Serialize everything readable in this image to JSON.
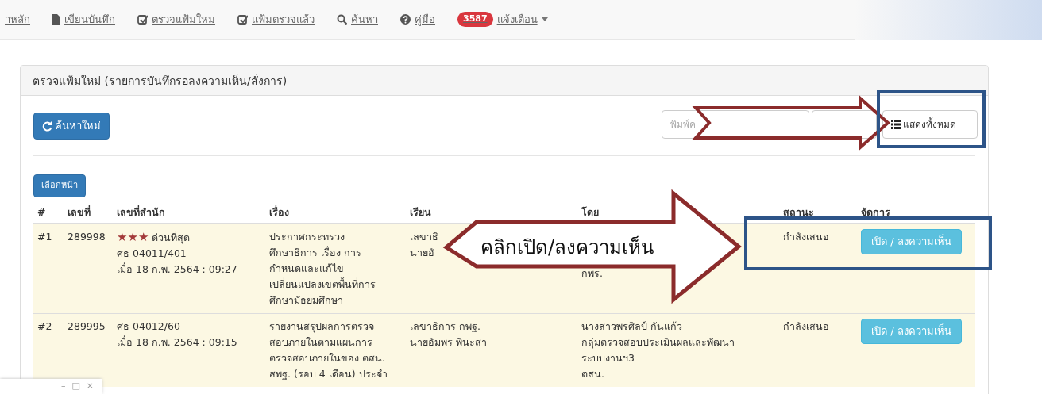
{
  "navbar": {
    "items": [
      {
        "kind": "text",
        "label": "าหลัก"
      },
      {
        "kind": "file",
        "label": "เขียนบันทึก"
      },
      {
        "kind": "check",
        "label": "ตรวจแฟ้มใหม่"
      },
      {
        "kind": "check",
        "label": "แฟ้มตรวจแล้ว"
      },
      {
        "kind": "search",
        "label": "ค้นหา"
      },
      {
        "kind": "help",
        "label": "คู่มือ"
      },
      {
        "kind": "alerts",
        "badge": "3587",
        "label": "แจ้งเตือน"
      }
    ]
  },
  "panel": {
    "title": "ตรวจแฟ้มใหม่ (รายการบันทึกรอลงความเห็น/สั่งการ)",
    "refresh_button": "ค้นหาใหม่",
    "search": {
      "placeholder": "พิมพ์ค"
    },
    "show_all_button": "แสดงทั้งหมด",
    "page_button": "เลือกหน้า",
    "table": {
      "columns": [
        "#",
        "เลขที่",
        "เลขที่สำนัก",
        "เรื่อง",
        "เรียน",
        "โดย",
        "สถานะ",
        "จัดการ"
      ],
      "rows": [
        {
          "num": "#1",
          "doc_no": "289998",
          "stars": 3,
          "priority": "ด่วนที่สุด",
          "ref": "ศธ 04011/401",
          "date": "เมื่อ 18 ก.พ. 2564 : 09:27",
          "subject": [
            "ประกาศกระทรวง",
            "ศึกษาธิการ เรื่อง การ",
            "กำหนดและแก้ไข",
            "เปลี่ยนแปลงเขตพื้นที่การ",
            "ศึกษามัธยมศึกษา"
          ],
          "to": [
            "เลขาธิ",
            "นายอั"
          ],
          "by": [
            "กพร."
          ],
          "status": "กำลังเสนอ",
          "action": "เปิด / ลงความเห็น"
        },
        {
          "num": "#2",
          "doc_no": "289995",
          "ref": "ศธ 04012/60",
          "date": "เมื่อ 18 ก.พ. 2564 : 09:15",
          "subject": [
            "รายงานสรุปผลการตรวจ",
            "สอบภายในตามแผนการ",
            "ตรวจสอบภายในของ ตสน.",
            "สพฐ. (รอบ 4 เดือน) ประจำ"
          ],
          "to": [
            "เลขาธิการ กพฐ.",
            "นายอัมพร พินะสา"
          ],
          "by": [
            "นางสาวพรศิลป์ กันแก้ว",
            "กลุ่มตรวจสอบประเมินผลและพัฒนา",
            "ระบบงานฯ3",
            "ตสน."
          ],
          "status": "กำลังเสนอ",
          "action": "เปิด / ลงความเห็น"
        }
      ]
    }
  },
  "annotation": {
    "callout": "คลิกเปิด/ลงความเห็น"
  },
  "mini_window": {
    "controls": [
      "–",
      "□",
      "×"
    ]
  }
}
